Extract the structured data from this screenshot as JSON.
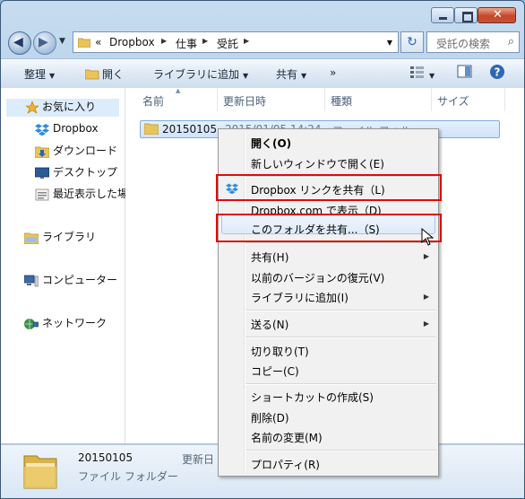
{
  "window": {
    "close_glyph": "✕"
  },
  "address": {
    "overflow": "«",
    "crumbs": [
      "Dropbox",
      "仕事",
      "受託"
    ],
    "search_placeholder": "受託の検索"
  },
  "toolbar": {
    "organize": "整理",
    "open": "開く",
    "add_to_library": "ライブラリに追加",
    "share": "共有",
    "more": "»"
  },
  "navpane": {
    "favorites": "お気に入り",
    "dropbox": "Dropbox",
    "downloads": "ダウンロード",
    "desktop": "デスクトップ",
    "recent": "最近表示した場",
    "libraries": "ライブラリ",
    "computer": "コンピューター",
    "network": "ネットワーク"
  },
  "columns": {
    "name": "名前",
    "modified": "更新日時",
    "type": "種類",
    "size": "サイズ"
  },
  "file": {
    "name": "20150105",
    "modified": "2015/01/05 14:24",
    "type": "ファイル フォル"
  },
  "context_menu": {
    "open": "開く(O)",
    "open_new_window": "新しいウィンドウで開く(E)",
    "dropbox_share_link": "Dropbox リンクを共有（L)",
    "view_on_dropbox": "Dropbox.com で表示（D)",
    "share_folder": "このフォルダを共有...（S)",
    "share_with": "共有(H)",
    "restore_previous": "以前のバージョンの復元(V)",
    "include_in_library": "ライブラリに追加(I)",
    "send_to": "送る(N)",
    "cut": "切り取り(T)",
    "copy": "コピー(C)",
    "create_shortcut": "ショートカットの作成(S)",
    "delete": "削除(D)",
    "rename": "名前の変更(M)",
    "properties": "プロパティ(R)"
  },
  "details": {
    "name": "20150105",
    "type": "ファイル フォルダー",
    "modified_label": "更新日"
  },
  "colors": {
    "highlight_red": "#e00a0a",
    "selection": "#cfe3f9",
    "dropbox_blue": "#2e8de3"
  },
  "icons": [
    "back-arrow-icon",
    "forward-arrow-icon",
    "folder-icon",
    "refresh-icon",
    "search-icon",
    "view-options-icon",
    "preview-pane-icon",
    "help-icon",
    "star-icon",
    "dropbox-icon",
    "mouse-cursor-icon"
  ]
}
